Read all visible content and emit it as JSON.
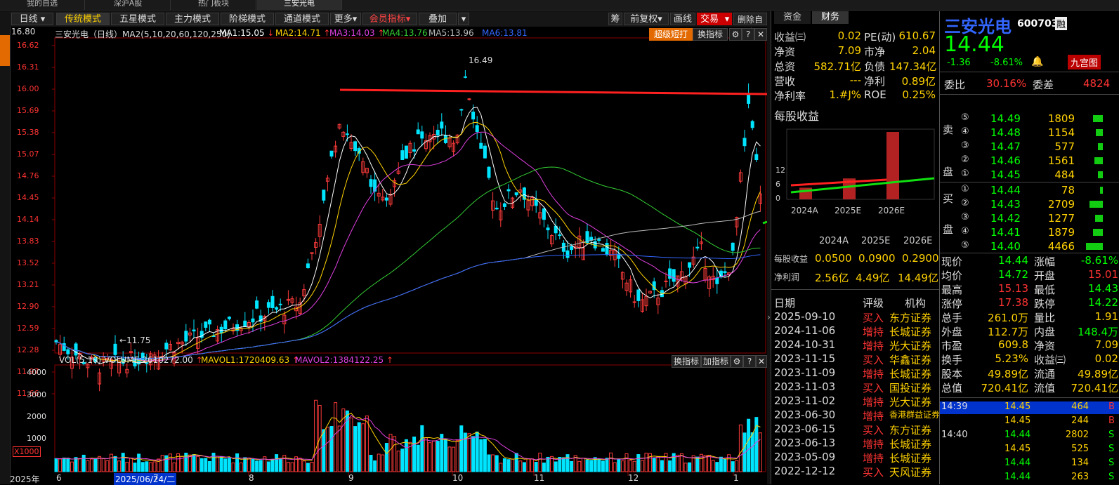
{
  "top_tabs": [
    "我的自选",
    "深沪A股",
    "热门板块",
    "三安光电"
  ],
  "toolbar": {
    "period": "日线",
    "modes": [
      "传统模式",
      "五星模式",
      "主力模式",
      "阶梯模式",
      "通道模式",
      "更多"
    ],
    "member": "会员指标",
    "overlay": "叠加",
    "right": [
      "筹",
      "前复权",
      "画线",
      "交易",
      "删除自选"
    ]
  },
  "main_info": {
    "ytop": "16.80",
    "title": "三安光电（日线）MA2(5,10,20,60,120,250)",
    "ma1": "MA1:15.05",
    "ma2": "MA2:14.71",
    "ma3": "MA3:14.03",
    "ma4": "MA4:13.76",
    "ma5": "MA5:13.96",
    "ma6": "MA6:13.81",
    "super_btn": "超级短打",
    "swap_btn": "换指标",
    "high_label": "16.49",
    "low_label": "11.75"
  },
  "price_axis": [
    "16.62",
    "16.31",
    "16.00",
    "15.69",
    "15.38",
    "15.07",
    "14.76",
    "14.45",
    "14.14",
    "13.83",
    "13.52",
    "13.21",
    "12.90",
    "12.59",
    "12.28",
    "11.97",
    "11.66"
  ],
  "vol_info": {
    "label": "VOL(5,10)",
    "volume": "VOLUME:2610272.00",
    "mavol1": "MAVOL1:1720409.63",
    "mavol2": "MAVOL2:1384122.25",
    "swap": "换指标",
    "add": "加指标",
    "axis": [
      "4000",
      "3000",
      "2000",
      "1000"
    ],
    "unit": "X1000"
  },
  "time_axis": {
    "year": "2025年",
    "cursor": "2025/06/24/二",
    "months": [
      "6",
      "7",
      "8",
      "9",
      "10",
      "11",
      "12",
      "1"
    ]
  },
  "fin": {
    "tabs": [
      "资金",
      "财务"
    ],
    "rows": [
      [
        "收益㈢",
        "0.02",
        "PE(动)",
        "610.67"
      ],
      [
        "净资",
        "7.09",
        "市净",
        "2.04"
      ],
      [
        "总资",
        "582.71亿",
        "负债",
        "147.34亿"
      ],
      [
        "营收",
        "---",
        "净利",
        "0.89亿"
      ],
      [
        "净利率",
        "1.#J%",
        "ROE",
        "0.25%"
      ]
    ],
    "eps_title": "每股收益",
    "eps_axis": [
      "12",
      "6",
      "0"
    ],
    "eps_years": [
      "2024A",
      "2025E",
      "2026E"
    ],
    "eps_values": [
      0.05,
      0.09,
      0.29
    ],
    "table_head": [
      "2024A",
      "2025E",
      "2026E"
    ],
    "eps_row": [
      "每股收益",
      "0.0500",
      "0.0900",
      "0.2900"
    ],
    "np_row": [
      "净利润",
      "2.56亿",
      "4.49亿",
      "14.49亿"
    ],
    "rating_head": [
      "日期",
      "评级",
      "机构"
    ],
    "ratings": [
      [
        "2025-09-10",
        "买入",
        "东方证券"
      ],
      [
        "2024-11-06",
        "增持",
        "长城证券"
      ],
      [
        "2024-10-31",
        "增持",
        "光大证券"
      ],
      [
        "2023-11-15",
        "买入",
        "华鑫证券"
      ],
      [
        "2023-11-09",
        "增持",
        "长城证券"
      ],
      [
        "2023-11-03",
        "买入",
        "国投证券"
      ],
      [
        "2023-11-02",
        "增持",
        "光大证券"
      ],
      [
        "2023-06-30",
        "增持",
        "香港群益证券"
      ],
      [
        "2023-06-15",
        "买入",
        "东方证券"
      ],
      [
        "2023-06-13",
        "增持",
        "长城证券"
      ],
      [
        "2023-05-09",
        "增持",
        "长城证券"
      ],
      [
        "2022-12-12",
        "买入",
        "天风证券"
      ]
    ]
  },
  "quote": {
    "name": "三安光电",
    "code": "600703",
    "rong": "融",
    "price": "14.44",
    "change": "-1.36",
    "pct": "-8.61%",
    "jgt": "九宫图",
    "wb_label": "委比",
    "wb": "30.16%",
    "wc_label": "委差",
    "wc": "4824",
    "sell_label": [
      "卖",
      "盘"
    ],
    "buy_label": [
      "买",
      "盘"
    ],
    "sells": [
      [
        "⑤",
        "14.49",
        "1809"
      ],
      [
        "④",
        "14.48",
        "1154"
      ],
      [
        "③",
        "14.47",
        "577"
      ],
      [
        "②",
        "14.46",
        "1561"
      ],
      [
        "①",
        "14.45",
        "484"
      ]
    ],
    "buys": [
      [
        "①",
        "14.44",
        "78"
      ],
      [
        "②",
        "14.43",
        "2709"
      ],
      [
        "③",
        "14.42",
        "1277"
      ],
      [
        "④",
        "14.41",
        "1879"
      ],
      [
        "⑤",
        "14.40",
        "4466"
      ]
    ],
    "stats": [
      [
        "现价",
        "14.44",
        "涨幅",
        "-8.61%"
      ],
      [
        "均价",
        "14.72",
        "开盘",
        "15.01"
      ],
      [
        "最高",
        "15.13",
        "最低",
        "14.43"
      ],
      [
        "涨停",
        "17.38",
        "跌停",
        "14.22"
      ],
      [
        "总手",
        "261.0万",
        "量比",
        "1.91"
      ],
      [
        "外盘",
        "112.7万",
        "内盘",
        "148.4万"
      ],
      [
        "市盈",
        "609.8",
        "净资",
        "7.09"
      ],
      [
        "换手",
        "5.23%",
        "收益㈢",
        "0.02"
      ],
      [
        "股本",
        "49.89亿",
        "流通",
        "49.89亿"
      ],
      [
        "总值",
        "720.41亿",
        "流值",
        "720.41亿"
      ]
    ],
    "ticks": [
      [
        "14:39",
        "14.45",
        "464",
        "B"
      ],
      [
        "",
        "14.45",
        "244",
        "B"
      ],
      [
        "14:40",
        "14.44",
        "2802",
        "S"
      ],
      [
        "",
        "14.45",
        "525",
        "S"
      ],
      [
        "",
        "14.44",
        "134",
        "S"
      ],
      [
        "",
        "14.44",
        "263",
        "S"
      ]
    ]
  }
}
